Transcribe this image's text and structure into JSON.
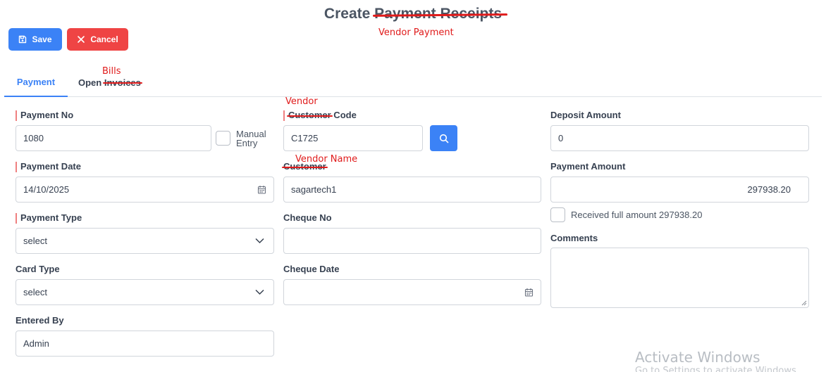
{
  "header": {
    "title_prefix": "Create",
    "title_struck": "Payment Receipts",
    "annotation": "Vendor Payment"
  },
  "toolbar": {
    "save_label": "Save",
    "cancel_label": "Cancel"
  },
  "tabs": {
    "payment": "Payment",
    "open_prefix": "Open",
    "open_struck": "Invoices",
    "open_annotation": "Bills"
  },
  "form": {
    "payment_no": {
      "label": "Payment No",
      "value": "1080"
    },
    "manual_entry": {
      "label_line1": "Manual",
      "label_line2": "Entry",
      "checked": false
    },
    "payment_date": {
      "label": "Payment Date",
      "value": "14/10/2025"
    },
    "payment_type": {
      "label": "Payment Type",
      "value": "select"
    },
    "card_type": {
      "label": "Card Type",
      "value": "select"
    },
    "entered_by": {
      "label": "Entered By",
      "value": "Admin"
    },
    "customer_code": {
      "label_struck": "Customer",
      "label_rest": " Code",
      "annotation": "Vendor",
      "value": "C1725"
    },
    "customer": {
      "label_struck": "Customer",
      "annotation": "Vendor Name",
      "value": "sagartech1"
    },
    "cheque_no": {
      "label": "Cheque No",
      "value": ""
    },
    "cheque_date": {
      "label": "Cheque Date",
      "value": ""
    },
    "deposit_amount": {
      "label": "Deposit Amount",
      "value": "0"
    },
    "payment_amount": {
      "label": "Payment Amount",
      "value": "297938.20"
    },
    "received_full": {
      "label": "Received full amount 297938.20",
      "checked": false
    },
    "comments": {
      "label": "Comments",
      "value": ""
    }
  },
  "watermark": {
    "line1": "Activate Windows",
    "line2": "Go to Settings to activate Windows."
  },
  "colors": {
    "primary": "#3b82f6",
    "danger": "#ef4444",
    "annotation": "#e01b1b"
  }
}
